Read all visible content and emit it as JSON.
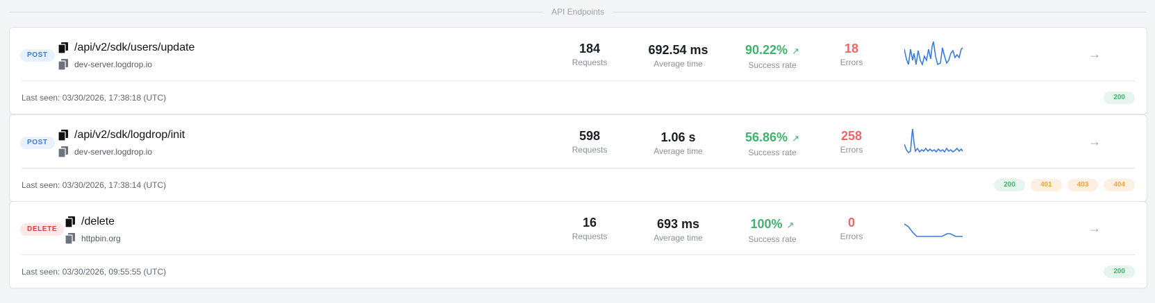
{
  "section_title": "API Endpoints",
  "endpoints": [
    {
      "method": "POST",
      "path": "/api/v2/sdk/users/update",
      "host": "dev-server.logdrop.io",
      "requests": "184",
      "requests_label": "Requests",
      "avg_time": "692.54 ms",
      "avg_time_label": "Average time",
      "success_rate": "90.22%",
      "success_label": "Success rate",
      "errors": "18",
      "errors_label": "Errors",
      "last_seen": "Last seen: 03/30/2026, 17:38:18 (UTC)",
      "status_codes": [
        "200"
      ]
    },
    {
      "method": "POST",
      "path": "/api/v2/sdk/logdrop/init",
      "host": "dev-server.logdrop.io",
      "requests": "598",
      "requests_label": "Requests",
      "avg_time": "1.06 s",
      "avg_time_label": "Average time",
      "success_rate": "56.86%",
      "success_label": "Success rate",
      "errors": "258",
      "errors_label": "Errors",
      "last_seen": "Last seen: 03/30/2026, 17:38:14 (UTC)",
      "status_codes": [
        "200",
        "401",
        "403",
        "404"
      ]
    },
    {
      "method": "DELETE",
      "path": "/delete",
      "host": "httpbin.org",
      "requests": "16",
      "requests_label": "Requests",
      "avg_time": "693 ms",
      "avg_time_label": "Average time",
      "success_rate": "100%",
      "success_label": "Success rate",
      "errors": "0",
      "errors_label": "Errors",
      "last_seen": "Last seen: 03/30/2026, 09:55:55 (UTC)",
      "status_codes": [
        "200"
      ]
    }
  ],
  "icons": {
    "copy": "copy-icon",
    "trend": "arrow-up-right-icon",
    "open": "arrow-right-icon"
  },
  "colors": {
    "success": "#3fb36b",
    "error": "#f06565",
    "sparkline": "#3b7be0",
    "post": "#3b7be0",
    "delete": "#e23b3b",
    "warn": "#f0a43a"
  }
}
